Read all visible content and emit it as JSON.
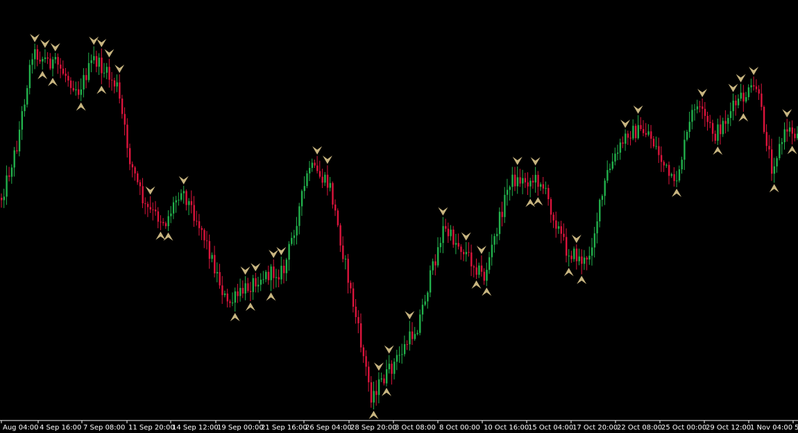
{
  "chart_data": {
    "type": "candlestick",
    "title": "",
    "xlabel": "",
    "ylabel": "",
    "x_tick_labels": [
      "Aug 04:00",
      "4 Sep 16:00",
      "7 Sep 08:00",
      "11 Sep 20:00",
      "14 Sep 12:00",
      "19 Sep 00:00",
      "21 Sep 16:00",
      "26 Sep 04:00",
      "28 Sep 20:00",
      "3 Oct 08:00",
      "8 Oct 00:00",
      "10 Oct 16:00",
      "15 Oct 04:00",
      "17 Oct 20:00",
      "22 Oct 08:00",
      "25 Oct 00:00",
      "29 Oct 12:00",
      "1 Nov 04:00",
      "5"
    ],
    "grid": false,
    "legend": "none",
    "price_path": [
      {
        "bar": 0,
        "close": 285
      },
      {
        "bar": 6,
        "close": 210
      },
      {
        "bar": 12,
        "close": 75
      },
      {
        "bar": 22,
        "close": 95
      },
      {
        "bar": 30,
        "close": 130
      },
      {
        "bar": 36,
        "close": 85
      },
      {
        "bar": 45,
        "close": 125
      },
      {
        "bar": 50,
        "close": 230
      },
      {
        "bar": 56,
        "close": 300
      },
      {
        "bar": 64,
        "close": 320
      },
      {
        "bar": 70,
        "close": 270
      },
      {
        "bar": 78,
        "close": 330
      },
      {
        "bar": 88,
        "close": 440
      },
      {
        "bar": 100,
        "close": 400
      },
      {
        "bar": 110,
        "close": 390
      },
      {
        "bar": 120,
        "close": 240
      },
      {
        "bar": 128,
        "close": 270
      },
      {
        "bar": 136,
        "close": 420
      },
      {
        "bar": 144,
        "close": 570
      },
      {
        "bar": 152,
        "close": 530
      },
      {
        "bar": 162,
        "close": 470
      },
      {
        "bar": 172,
        "close": 330
      },
      {
        "bar": 180,
        "close": 360
      },
      {
        "bar": 188,
        "close": 400
      },
      {
        "bar": 198,
        "close": 260
      },
      {
        "bar": 210,
        "close": 260
      },
      {
        "bar": 220,
        "close": 360
      },
      {
        "bar": 228,
        "close": 380
      },
      {
        "bar": 236,
        "close": 250
      },
      {
        "bar": 244,
        "close": 190
      },
      {
        "bar": 252,
        "close": 190
      },
      {
        "bar": 262,
        "close": 270
      },
      {
        "bar": 270,
        "close": 150
      },
      {
        "bar": 278,
        "close": 195
      },
      {
        "bar": 286,
        "close": 150
      },
      {
        "bar": 294,
        "close": 125
      },
      {
        "bar": 300,
        "close": 240
      },
      {
        "bar": 306,
        "close": 185
      },
      {
        "bar": 312,
        "close": 200
      }
    ],
    "bull_color": "#22b14c",
    "bear_color": "#dc143c",
    "marker_color": "#c8b580",
    "background": "#000000"
  }
}
